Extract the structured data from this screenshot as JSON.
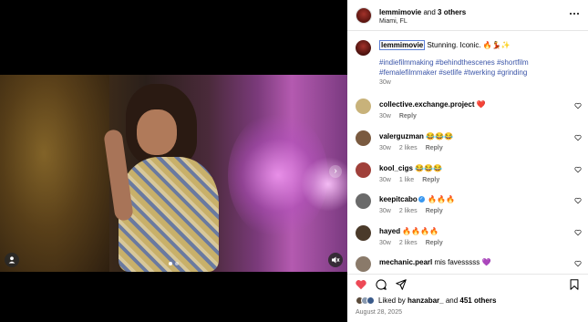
{
  "header": {
    "username": "lemmimovie",
    "and_text": " and ",
    "others": "3 others",
    "location": "Miami, FL",
    "more_icon": "more-horizontal-icon"
  },
  "caption": {
    "username": "lemmimovie",
    "text": " Stunning. Iconic. 🔥💃✨",
    "hashtags": "#indiefilmmaking #behindthescenes #shortfilm #femalefilmmaker #setlife #twerking #grinding",
    "time": "30w"
  },
  "comments": [
    {
      "user": "collective.exchange.project",
      "text": " ❤️",
      "time": "30w",
      "likes": "",
      "reply": "Reply",
      "avatar_color": "#c8b27a"
    },
    {
      "user": "valerguzman",
      "text": " 😂😂😂",
      "time": "30w",
      "likes": "2 likes",
      "reply": "Reply",
      "avatar_color": "#7a5a40"
    },
    {
      "user": "kool_cigs",
      "text": " 😂😂😂",
      "time": "30w",
      "likes": "1 like",
      "reply": "Reply",
      "avatar_color": "#a0403a"
    },
    {
      "user": "keepitcabo",
      "text": " 🔥🔥🔥",
      "time": "30w",
      "likes": "2 likes",
      "reply": "Reply",
      "avatar_color": "#6a6a6a",
      "verified": true
    },
    {
      "user": "hayed",
      "text": " 🔥🔥🔥🔥",
      "time": "30w",
      "likes": "2 likes",
      "reply": "Reply",
      "avatar_color": "#4a3a2a"
    },
    {
      "user": "mechanic.pearl",
      "text": " mis favesssss 💜",
      "time": "",
      "likes": "",
      "reply": "",
      "avatar_color": "#8a7a6a"
    }
  ],
  "likes": {
    "prefix": "Liked by ",
    "user": "hanzabar_",
    "middle": " and ",
    "count": "451 others"
  },
  "date": "August 28, 2025",
  "colors": {
    "like_red": "#ed4956",
    "link_blue": "#3b55a8",
    "muted": "#737373"
  }
}
